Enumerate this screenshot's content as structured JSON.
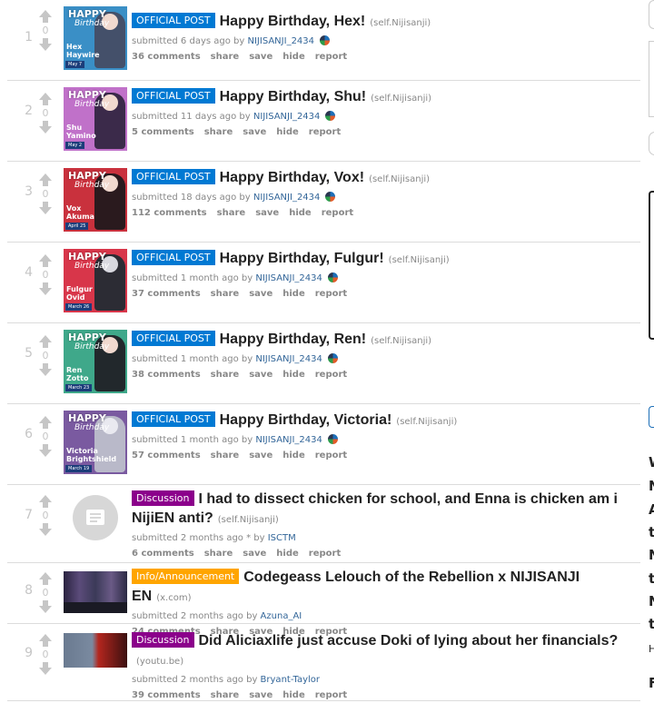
{
  "colors": {
    "official_flair": "#0079d3",
    "discussion_flair": "#8b008b",
    "info_flair": "#ffa500",
    "author_link": "#336699",
    "meta_text": "#888888",
    "arrow": "#c6c6c6"
  },
  "posts": [
    {
      "rank": "1",
      "score": "0",
      "flair": "OFFICIAL POST",
      "title": "Happy Birthday, Hex!",
      "domain": "(self.Nijisanji)",
      "submitted": "submitted 6 days ago by",
      "author": "NIJISANJI_2434",
      "comments": "36 comments",
      "thumb": {
        "hb": "HAPPY",
        "hb2": "Birthday",
        "who": "Hex Haywire",
        "date": "May 7",
        "bg": "#3a8fc6",
        "fig": "#44506a"
      }
    },
    {
      "rank": "2",
      "score": "0",
      "flair": "OFFICIAL POST",
      "title": "Happy Birthday, Shu!",
      "domain": "(self.Nijisanji)",
      "submitted": "submitted 11 days ago by",
      "author": "NIJISANJI_2434",
      "comments": "5 comments",
      "thumb": {
        "hb": "HAPPY",
        "hb2": "Birthday",
        "who": "Shu Yamino",
        "date": "May 2",
        "bg": "#c071c9",
        "fig": "#3b2a4a"
      }
    },
    {
      "rank": "3",
      "score": "0",
      "flair": "OFFICIAL POST",
      "title": "Happy Birthday, Vox!",
      "domain": "(self.Nijisanji)",
      "submitted": "submitted 18 days ago by",
      "author": "NIJISANJI_2434",
      "comments": "112 comments",
      "thumb": {
        "hb": "HAPPY",
        "hb2": "Birthday",
        "who": "Vox Akuma",
        "date": "April 25",
        "bg": "#c9313d",
        "fig": "#2a1a1e"
      }
    },
    {
      "rank": "4",
      "score": "0",
      "flair": "OFFICIAL POST",
      "title": "Happy Birthday, Fulgur!",
      "domain": "(self.Nijisanji)",
      "submitted": "submitted 1 month ago by",
      "author": "NIJISANJI_2434",
      "comments": "37 comments",
      "thumb": {
        "hb": "HAPPY",
        "hb2": "Birthday",
        "who": "Fulgur Ovid",
        "date": "March 26",
        "bg": "#d8364a",
        "fig": "#2c2c34"
      }
    },
    {
      "rank": "5",
      "score": "0",
      "flair": "OFFICIAL POST",
      "title": "Happy Birthday, Ren!",
      "domain": "(self.Nijisanji)",
      "submitted": "submitted 1 month ago by",
      "author": "NIJISANJI_2434",
      "comments": "38 comments",
      "thumb": {
        "hb": "HAPPY",
        "hb2": "Birthday",
        "who": "Ren Zotto",
        "date": "March 23",
        "bg": "#3fa88a",
        "fig": "#22282c"
      }
    },
    {
      "rank": "6",
      "score": "0",
      "flair": "OFFICIAL POST",
      "title": "Happy Birthday, Victoria!",
      "domain": "(self.Nijisanji)",
      "submitted": "submitted 1 month ago by",
      "author": "NIJISANJI_2434",
      "comments": "57 comments",
      "thumb": {
        "hb": "HAPPY",
        "hb2": "Birthday",
        "who": "Victoria Brightshield",
        "date": "March 19",
        "bg": "#7a5aa0",
        "fig": "#b9b9c9"
      }
    },
    {
      "rank": "7",
      "score": "0",
      "flair": "Discussion",
      "title": "I had to dissect chicken for school, and Enna is chicken am i NijiEN anti?",
      "domain": "(self.Nijisanji)",
      "submitted": "submitted 2 months ago * by",
      "author": "ISCTM",
      "comments": "6 comments"
    },
    {
      "rank": "8",
      "score": "0",
      "flair": "Info/Announcement",
      "title": "Codegeass Lelouch of the Rebellion x NIJISANJI EN",
      "domain": "(x.com)",
      "submitted": "submitted 2 months ago by",
      "author": "Azuna_AI",
      "comments": "24 comments"
    },
    {
      "rank": "9",
      "score": "0",
      "flair": "Discussion",
      "title": "Did Aliciaxlife just accuse Doki of lying about her financials?",
      "domain": "(youtu.be)",
      "submitted": "submitted 2 months ago by",
      "author": "Bryant-Taylor",
      "comments": "39 comments"
    }
  ],
  "actions": {
    "share": "share",
    "save": "save",
    "hide": "hide",
    "report": "report"
  },
  "sidebar_fragment": {
    "letters": [
      "W",
      "N",
      "A",
      "t",
      "N",
      "t",
      "N",
      "t"
    ],
    "small": "H",
    "last": "F"
  }
}
